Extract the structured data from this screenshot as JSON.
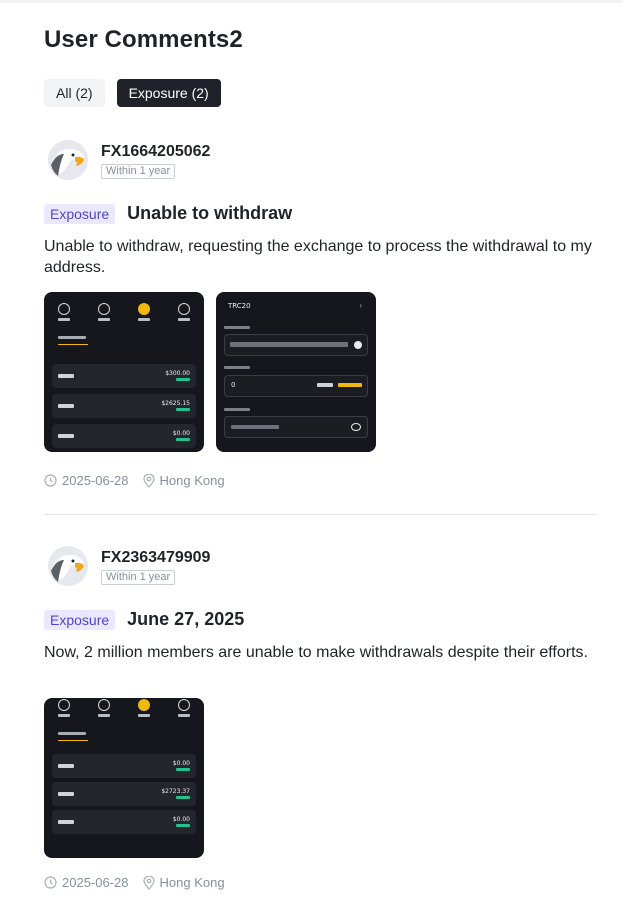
{
  "page": {
    "title": "User Comments2"
  },
  "tabs": [
    {
      "label": "All (2)",
      "active": false
    },
    {
      "label": "Exposure (2)",
      "active": true
    }
  ],
  "comments": [
    {
      "username": "FX1664205062",
      "badge": "Within 1 year",
      "tag": "Exposure",
      "title": "Unable to withdraw",
      "body": "Unable to withdraw, requesting the exchange to process the withdrawal to my address.",
      "date": "2025-06-28",
      "location": "Hong Kong",
      "thumb_values": {
        "a1": "$300.00",
        "a2": "$2625.15",
        "a3": "$0.00",
        "network": "TRC20",
        "amount": "0"
      }
    },
    {
      "username": "FX2363479909",
      "badge": "Within 1 year",
      "tag": "Exposure",
      "title": "June 27, 2025",
      "body": "Now, 2 million members are unable to make withdrawals despite their efforts.",
      "date": "2025-06-28",
      "location": "Hong Kong",
      "thumb_values": {
        "a1": "$0.00",
        "a2": "$2723.37",
        "a3": "$0.00"
      }
    }
  ],
  "icons": {
    "clock": "clock-icon",
    "location": "location-pin-icon",
    "avatar": "eagle-avatar"
  },
  "colors": {
    "tag_bg": "#eae8ff",
    "tag_text": "#4f46c9",
    "active_tab_bg": "#1f2329",
    "gold": "#f0b90b"
  }
}
